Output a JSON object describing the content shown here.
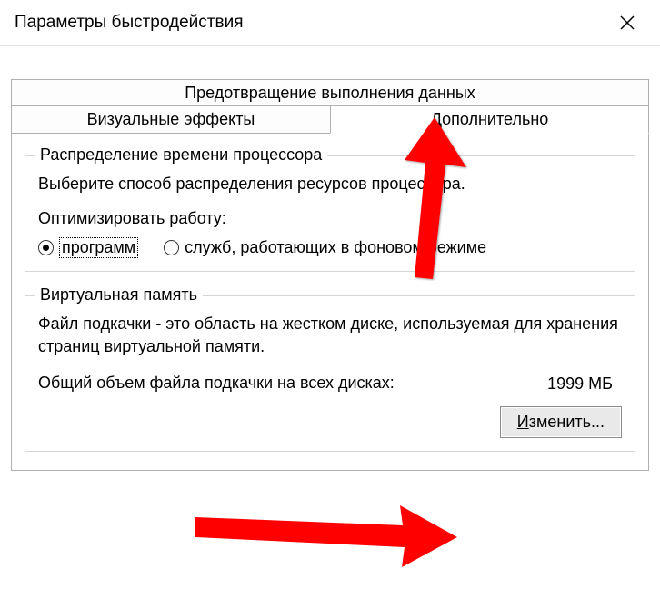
{
  "window": {
    "title": "Параметры быстродействия"
  },
  "tabs": {
    "dep": "Предотвращение выполнения данных",
    "visual": "Визуальные эффекты",
    "advanced": "Дополнительно"
  },
  "cpu": {
    "group_title": "Распределение времени процессора",
    "desc": "Выберите способ распределения ресурсов процессора.",
    "opt_label": "Оптимизировать работу:",
    "radio_programs": "программ",
    "radio_services": "служб, работающих в фоновом режиме"
  },
  "vm": {
    "group_title": "Виртуальная память",
    "desc": "Файл подкачки - это область на жестком диске, используемая для хранения страниц виртуальной памяти.",
    "total_label": "Общий объем файла подкачки на всех дисках:",
    "total_value": "1999 МБ",
    "change_btn_rest": "зменить...",
    "change_btn_u": "И"
  }
}
